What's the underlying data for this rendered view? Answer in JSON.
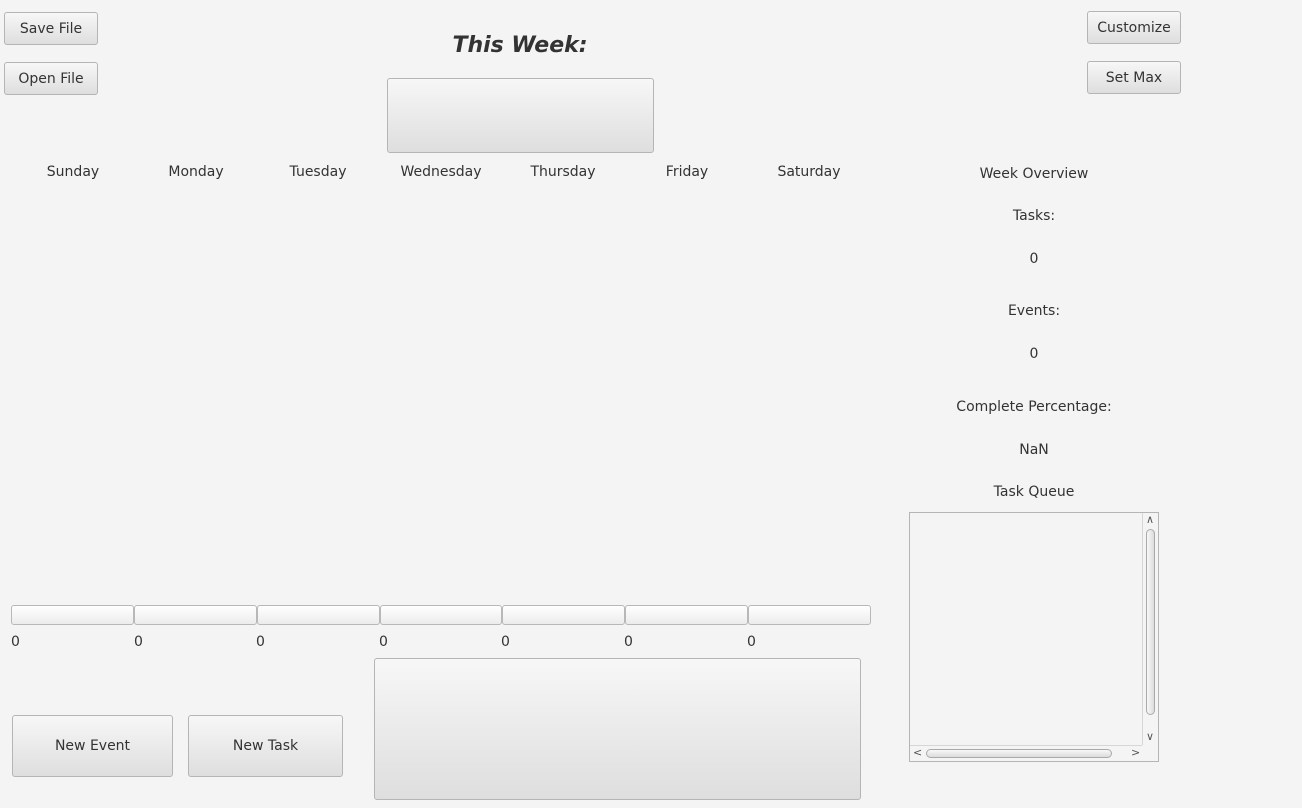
{
  "toolbar": {
    "save_file": "Save File",
    "open_file": "Open File",
    "customize": "Customize",
    "set_max": "Set Max"
  },
  "header": {
    "title": "This Week:"
  },
  "days": [
    "Sunday",
    "Monday",
    "Tuesday",
    "Wednesday",
    "Thursday",
    "Friday",
    "Saturday"
  ],
  "day_counts": [
    "0",
    "0",
    "0",
    "0",
    "0",
    "0",
    "0"
  ],
  "day_progress": [
    0,
    0,
    0,
    0,
    0,
    0,
    0
  ],
  "overview": {
    "heading": "Week Overview",
    "tasks_label": "Tasks:",
    "tasks_value": "0",
    "events_label": "Events:",
    "events_value": "0",
    "complete_label": "Complete Percentage:",
    "complete_value": "NaN",
    "queue_label": "Task Queue"
  },
  "actions": {
    "new_event": "New Event",
    "new_task": "New Task"
  },
  "scrollbar": {
    "up": "∧",
    "down": "∨",
    "left": "<",
    "right": ">"
  }
}
